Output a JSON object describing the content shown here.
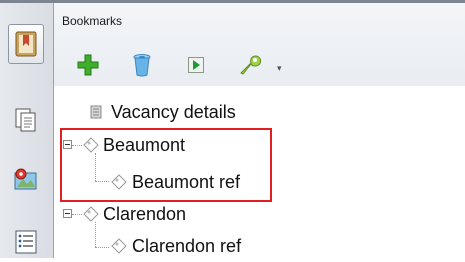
{
  "panel": {
    "title": "Bookmarks"
  },
  "toolbar": {
    "add_icon": "plus-icon",
    "delete_icon": "trash-icon",
    "goto_icon": "play-icon",
    "options_icon": "wrench-icon",
    "options_dropdown": "▾"
  },
  "sidebar": {
    "items": [
      {
        "icon": "bookmark-icon",
        "active": true
      },
      {
        "icon": "pages-icon",
        "active": false
      },
      {
        "icon": "map-icon",
        "active": false
      },
      {
        "icon": "list-icon",
        "active": false
      }
    ]
  },
  "tree": {
    "items": [
      {
        "label": "Vacancy details"
      },
      {
        "label": "Beaumont"
      },
      {
        "label": "Beaumont ref"
      },
      {
        "label": "Clarendon"
      },
      {
        "label": "Clarendon ref"
      }
    ]
  },
  "colors": {
    "highlight": "#e02020",
    "add_green": "#3fae2a",
    "trash_blue": "#6ab3e6"
  }
}
